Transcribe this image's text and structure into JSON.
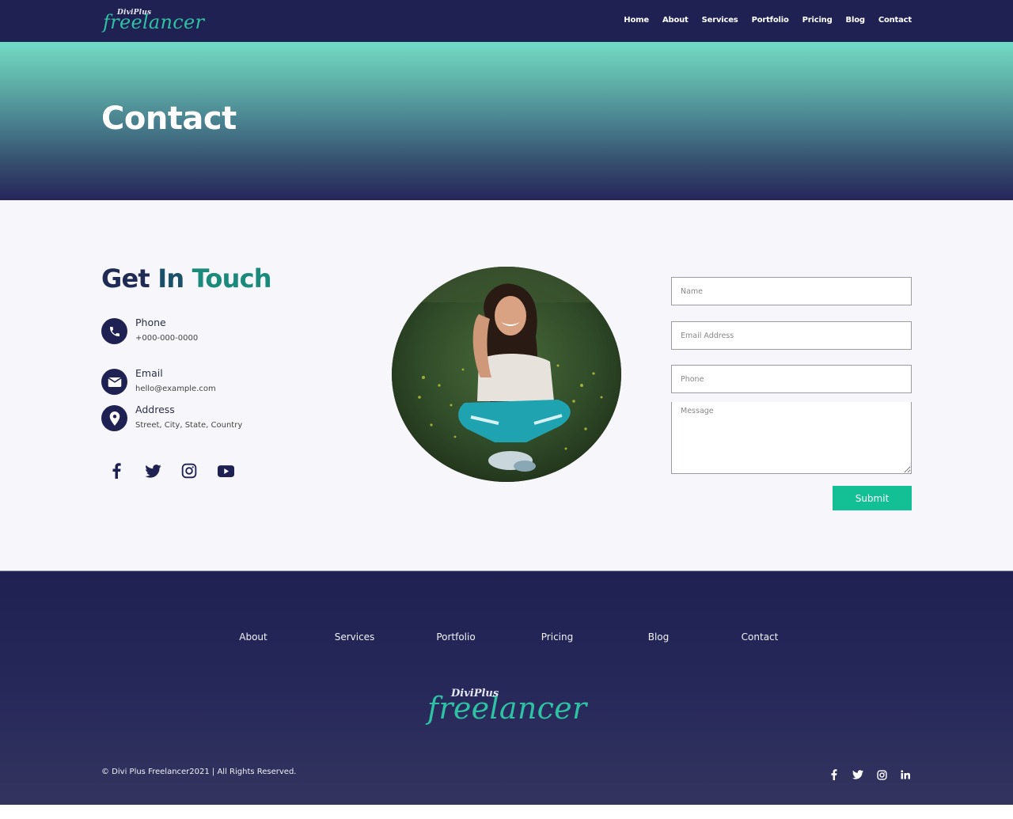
{
  "header": {
    "logo_small": "DiviPlus",
    "logo_big": "freelancer",
    "nav": [
      "Home",
      "About",
      "Services",
      "Portfolio",
      "Pricing",
      "Blog",
      "Contact"
    ]
  },
  "hero": {
    "title": "Contact"
  },
  "contact_section": {
    "heading_words": [
      "Get",
      "In",
      "Touch"
    ],
    "items": [
      {
        "icon": "phone-icon",
        "label": "Phone",
        "value": "+000-000-0000"
      },
      {
        "icon": "envelope-icon",
        "label": "Email",
        "value": "hello@example.com"
      },
      {
        "icon": "map-pin-icon",
        "label": "Address",
        "value": "Street, City, State, Country"
      }
    ],
    "socials": [
      "facebook-icon",
      "twitter-icon",
      "instagram-icon",
      "youtube-icon"
    ],
    "photo_alt": "Smiling woman sitting on grass"
  },
  "form": {
    "name_placeholder": "Name",
    "email_placeholder": "Email Address",
    "phone_placeholder": "Phone",
    "message_placeholder": "Message",
    "submit_label": "Submit"
  },
  "footer": {
    "nav": [
      "About",
      "Services",
      "Portfolio",
      "Pricing",
      "Blog",
      "Contact"
    ],
    "logo_small": "DiviPlus",
    "logo_big": "freelancer",
    "copyright": "© Divi Plus Freelancer2021 | All Rights Reserved.",
    "socials": [
      "facebook-icon",
      "twitter-icon",
      "instagram-icon",
      "linkedin-icon"
    ]
  },
  "colors": {
    "navy": "#1f2152",
    "teal_accent": "#2fc1a3",
    "submit_green": "#13c095",
    "hero_top": "#72dcc5",
    "page_bg": "#f7f7fb"
  }
}
